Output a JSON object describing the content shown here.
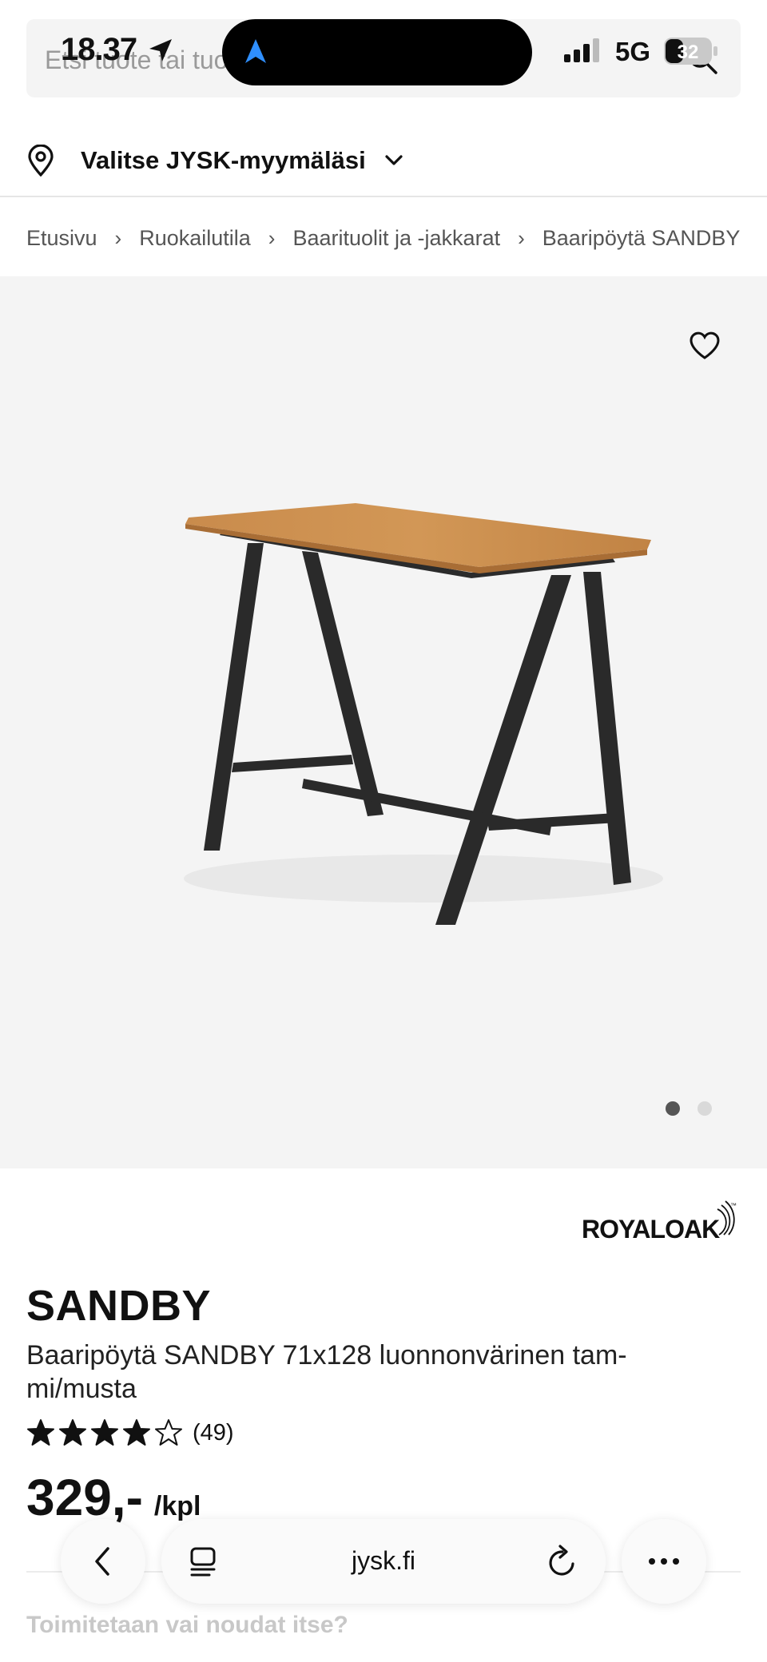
{
  "status_bar": {
    "time": "18.37",
    "network": "5G",
    "battery": "32"
  },
  "search": {
    "placeholder": "Etsi tuote tai tuotenumero"
  },
  "store": {
    "label": "Valitse JYSK-myymäläsi"
  },
  "breadcrumb": [
    "Etusivu",
    "Ruokailutila",
    "Baarituolit ja -jakkarat",
    "Baaripöytä SANDBY"
  ],
  "gallery": {
    "image_count": 2,
    "active_index": 0
  },
  "product": {
    "brand": "ROYALOAK",
    "brand_tm": "™",
    "title": "SANDBY",
    "description": "Baaripöytä SANDBY 71x128 luonnonvärinen tam-mi/musta",
    "rating_value": 4,
    "rating_max": 5,
    "rating_count": "(49)",
    "price": "329,-",
    "unit": "/kpl",
    "delivery_heading": "Toimitetaan vai noudat itse?"
  },
  "browser": {
    "domain": "jysk.fi"
  },
  "colors": {
    "gallery_bg": "#f4f4f4",
    "text": "#111111",
    "muted": "#555555",
    "nav_arrow": "#1e90ff"
  }
}
